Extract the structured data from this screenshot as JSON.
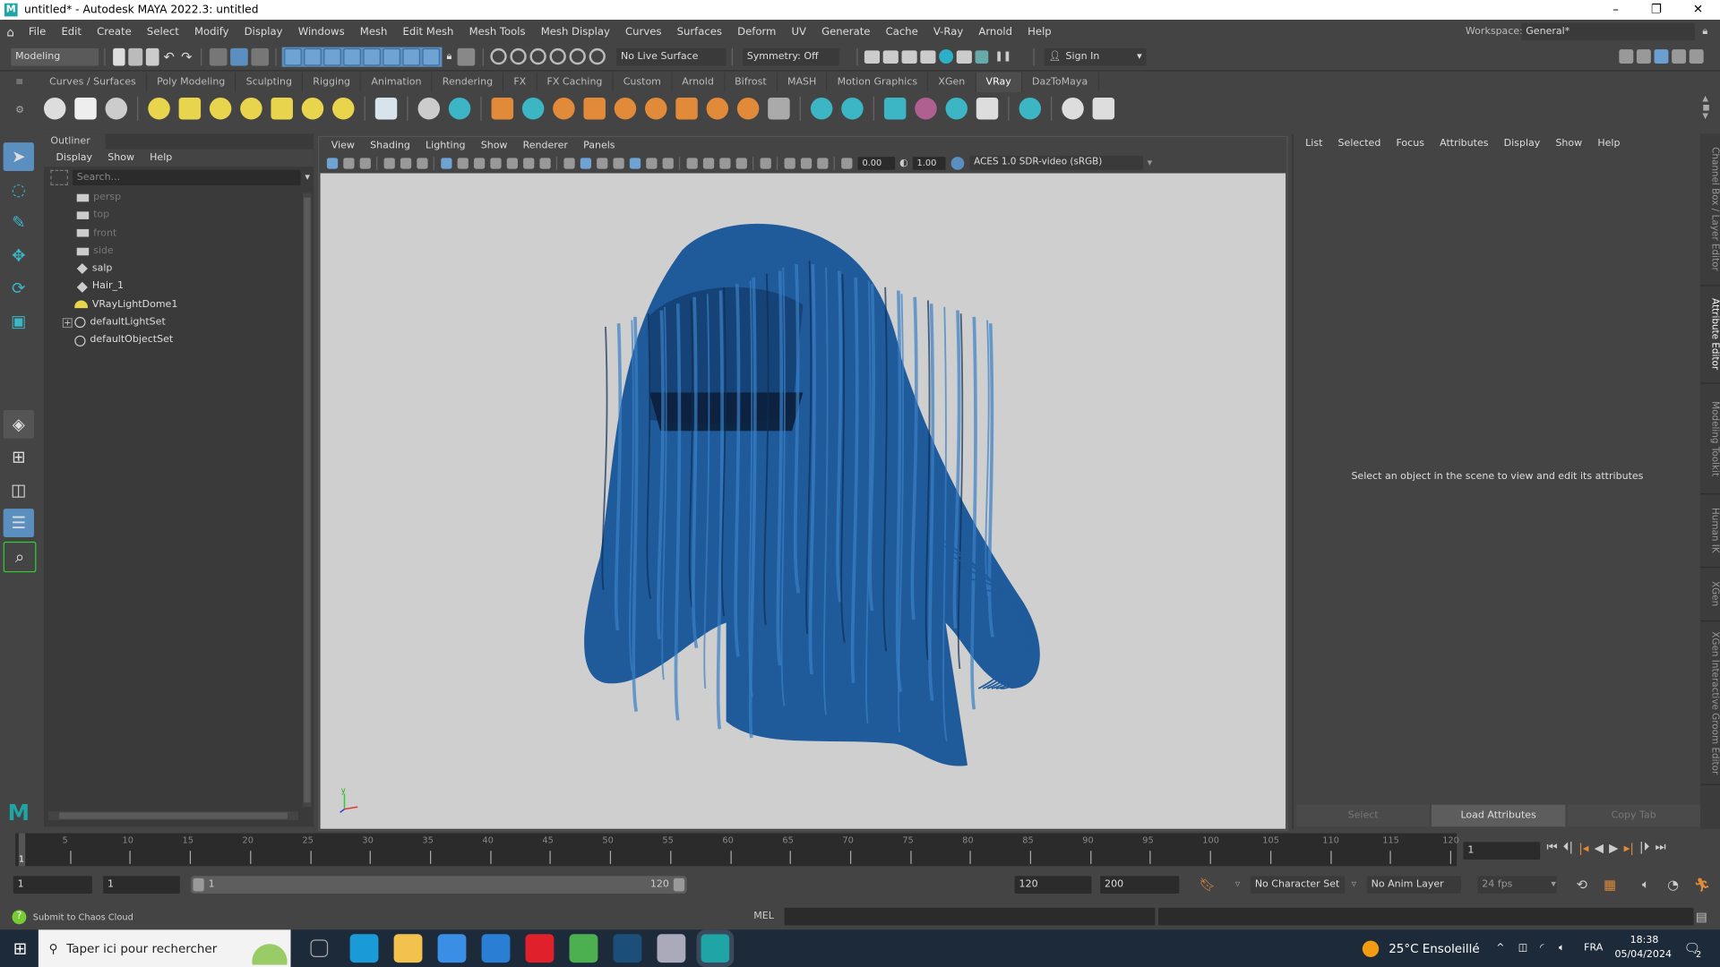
{
  "window": {
    "title": "untitled* - Autodesk MAYA 2022.3: untitled",
    "minimize": "–",
    "maximize": "❐",
    "close": "✕"
  },
  "menubar": {
    "items": [
      "File",
      "Edit",
      "Create",
      "Select",
      "Modify",
      "Display",
      "Windows",
      "Mesh",
      "Edit Mesh",
      "Mesh Tools",
      "Mesh Display",
      "Curves",
      "Surfaces",
      "Deform",
      "UV",
      "Generate",
      "Cache",
      "V-Ray",
      "Arnold",
      "Help"
    ],
    "workspace_label": "Workspace:",
    "workspace_value": "General*"
  },
  "statusline": {
    "mode": "Modeling",
    "live_surface": "No Live Surface",
    "symmetry": "Symmetry: Off",
    "sign_in": "Sign In"
  },
  "shelf": {
    "tabs": [
      "Curves / Surfaces",
      "Poly Modeling",
      "Sculpting",
      "Rigging",
      "Animation",
      "Rendering",
      "FX",
      "FX Caching",
      "Custom",
      "Arnold",
      "Bifrost",
      "MASH",
      "Motion Graphics",
      "XGen",
      "VRay",
      "DazToMaya"
    ],
    "active_tab": "VRay",
    "icons": [
      [
        "vray-render-icon",
        "#ddd"
      ],
      [
        "vray-ipr-icon",
        "#eee"
      ],
      [
        "vray-vfb-icon",
        "#ccc"
      ],
      [
        "vray-settings-icon",
        "#e8d44d"
      ],
      [
        "vray-light-dome-icon",
        "#e8d44d"
      ],
      [
        "vray-rect-light-icon",
        "#e8d44d"
      ],
      [
        "vray-sphere-light-icon",
        "#e8d44d"
      ],
      [
        "vray-mesh-light-icon",
        "#e8d44d"
      ],
      [
        "vray-ies-light-icon",
        "#e8d44d"
      ],
      [
        "vray-sun-icon",
        "#e8d44d"
      ],
      [
        "vray-plane-icon",
        "#d8e4ec"
      ],
      [
        "vray-proxy-icon",
        "#ccc"
      ],
      [
        "vray-proxy-export-icon",
        "#3cb5c4"
      ],
      [
        "vray-scene-icon",
        "#e08a3a"
      ],
      [
        "vray-fur-icon",
        "#3cb5c4"
      ],
      [
        "vray-mtl-icon",
        "#e08a3a"
      ],
      [
        "vray-hair-icon",
        "#e08a3a"
      ],
      [
        "vray-fur-alt-icon",
        "#e08a3a"
      ],
      [
        "vray-grid-icon",
        "#e08a3a"
      ],
      [
        "vray-clipper-icon",
        "#e08a3a"
      ],
      [
        "vray-sphere-fade-icon",
        "#e08a3a"
      ],
      [
        "vray-toon-icon",
        "#e08a3a"
      ],
      [
        "vray-gear-icon",
        "#aaa"
      ],
      [
        "vray-object-props-icon",
        "#3cb5c4"
      ],
      [
        "vray-displacement-icon",
        "#3cb5c4"
      ],
      [
        "vray-file-icon",
        "#3cb5c4"
      ],
      [
        "vray-material-ball-icon",
        "#b06090"
      ],
      [
        "vray-multi-icon",
        "#3cb5c4"
      ],
      [
        "vray-palette-icon",
        "#ddd"
      ],
      [
        "vray-layout-icon",
        "#3cb5c4"
      ],
      [
        "vray-plugin-icon",
        "#ddd"
      ],
      [
        "vray-logo-icon",
        "#ddd"
      ]
    ]
  },
  "outliner": {
    "title": "Outliner",
    "menu": [
      "Display",
      "Show",
      "Help"
    ],
    "search_placeholder": "Search...",
    "items": [
      {
        "label": "persp",
        "type": "camera",
        "dim": true
      },
      {
        "label": "top",
        "type": "camera",
        "dim": true
      },
      {
        "label": "front",
        "type": "camera",
        "dim": true
      },
      {
        "label": "side",
        "type": "camera",
        "dim": true
      },
      {
        "label": "salp",
        "type": "transform",
        "dim": false
      },
      {
        "label": "Hair_1",
        "type": "transform",
        "dim": false
      },
      {
        "label": "VRayLightDome1",
        "type": "light",
        "dim": false
      },
      {
        "label": "defaultLightSet",
        "type": "set",
        "dim": false,
        "expandable": true
      },
      {
        "label": "defaultObjectSet",
        "type": "set",
        "dim": false
      }
    ]
  },
  "viewport": {
    "menu": [
      "View",
      "Shading",
      "Lighting",
      "Show",
      "Renderer",
      "Panels"
    ],
    "exposure": "0.00",
    "gamma": "1.00",
    "color_space": "ACES 1.0 SDR-video (sRGB)",
    "axis_label": "y",
    "hair_color": "#1f5a9a"
  },
  "attribute_editor": {
    "menu": [
      "List",
      "Selected",
      "Focus",
      "Attributes",
      "Display",
      "Show",
      "Help"
    ],
    "message": "Select an object in the scene to view and edit its attributes",
    "buttons": [
      "Select",
      "Load Attributes",
      "Copy Tab"
    ]
  },
  "side_tabs": [
    {
      "label": "Channel Box / Layer Editor",
      "active": false
    },
    {
      "label": "Attribute Editor",
      "active": true
    },
    {
      "label": "Modeling Toolkit",
      "active": false
    },
    {
      "label": "Human IK",
      "active": false
    },
    {
      "label": "XGen",
      "active": false
    },
    {
      "label": "XGen Interactive Groom Editor",
      "active": false
    }
  ],
  "timeline": {
    "start": 1,
    "end": 120,
    "labels": [
      "5",
      "10",
      "15",
      "20",
      "25",
      "30",
      "35",
      "40",
      "45",
      "50",
      "55",
      "60",
      "65",
      "70",
      "75",
      "80",
      "85",
      "90",
      "95",
      "100",
      "105",
      "110",
      "115",
      "120"
    ],
    "current_frame": "1",
    "current_field": "1"
  },
  "range": {
    "start_field": "1",
    "playback_start": "1",
    "slider_start": "1",
    "slider_end": "120",
    "playback_end": "120",
    "end_field": "200",
    "character_set": "No Character Set",
    "anim_layer": "No Anim Layer",
    "fps": "24 fps"
  },
  "cmdline": {
    "help_text": "Submit to Chaos Cloud",
    "lang": "MEL"
  },
  "taskbar": {
    "search_placeholder": "Taper ici pour rechercher",
    "weather": "25°C  Ensoleillé",
    "lang": "FRA",
    "time": "18:38",
    "date": "05/04/2024",
    "notifications": "2",
    "apps": [
      [
        "task-view-icon",
        "#1d2a3a"
      ],
      [
        "edge-icon",
        "#1a9bd7"
      ],
      [
        "file-explorer-icon",
        "#f2c14e"
      ],
      [
        "store-icon",
        "#3a8ee6"
      ],
      [
        "mail-icon",
        "#2a7fd4"
      ],
      [
        "opera-icon",
        "#e0202a"
      ],
      [
        "chrome-icon",
        "#4caf50"
      ],
      [
        "steam-icon",
        "#1b4f7a"
      ],
      [
        "app-icon",
        "#aab"
      ],
      [
        "maya-icon",
        "#1fa5a5"
      ]
    ]
  }
}
